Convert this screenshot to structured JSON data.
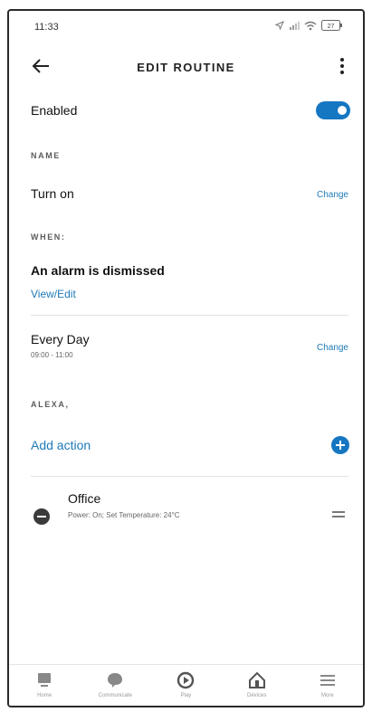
{
  "status": {
    "time": "11:33",
    "battery": "27"
  },
  "header": {
    "title": "EDIT ROUTINE"
  },
  "enabled": {
    "label": "Enabled",
    "on": true
  },
  "name_section": {
    "heading": "NAME",
    "value": "Turn on",
    "change": "Change"
  },
  "when_section": {
    "heading": "WHEN:",
    "trigger": "An alarm is dismissed",
    "view_edit": "View/Edit",
    "schedule_title": "Every Day",
    "schedule_time": "09:00 - 11:00",
    "change": "Change"
  },
  "alexa_section": {
    "heading": "ALEXA,",
    "add_action": "Add action"
  },
  "action": {
    "title": "Office",
    "detail": "Power: On; Set Temperature: 24°C"
  },
  "bottom_nav": {
    "items": [
      {
        "label": "Home",
        "icon": "home-icon"
      },
      {
        "label": "Communicate",
        "icon": "communicate-icon"
      },
      {
        "label": "Play",
        "icon": "play-icon"
      },
      {
        "label": "Devices",
        "icon": "devices-icon"
      },
      {
        "label": "More",
        "icon": "menu-icon"
      }
    ]
  },
  "colors": {
    "accent": "#1576C2",
    "link": "#1D7AB8",
    "text": "#1B1B1B"
  }
}
